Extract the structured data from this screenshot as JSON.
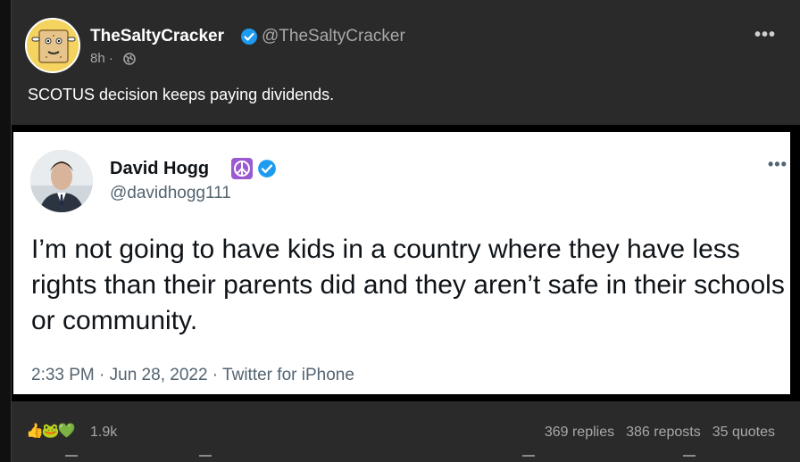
{
  "post": {
    "author_name": "TheSaltyCracker",
    "author_handle": "@TheSaltyCracker",
    "time": "8h ·",
    "text": "SCOTUS decision keeps paying dividends.",
    "more_label": "•••"
  },
  "embedded_tweet": {
    "name": "David Hogg",
    "handle": "@davidhogg111",
    "text": "I’m not going to have kids in a country where they have less rights than their parents did and they aren’t safe in their schools or community.",
    "meta": "2:33 PM · Jun 28, 2022 · Twitter for iPhone",
    "more_label": "•••"
  },
  "footer": {
    "reactions": "👍🐸💚",
    "reaction_count": "1.9k",
    "replies": "369 replies",
    "reposts": "386 reposts",
    "quotes": "35 quotes"
  },
  "colors": {
    "verified": "#1d9bf0",
    "peace": "#9b59d0",
    "avatar_bg": "#f4d35e"
  }
}
